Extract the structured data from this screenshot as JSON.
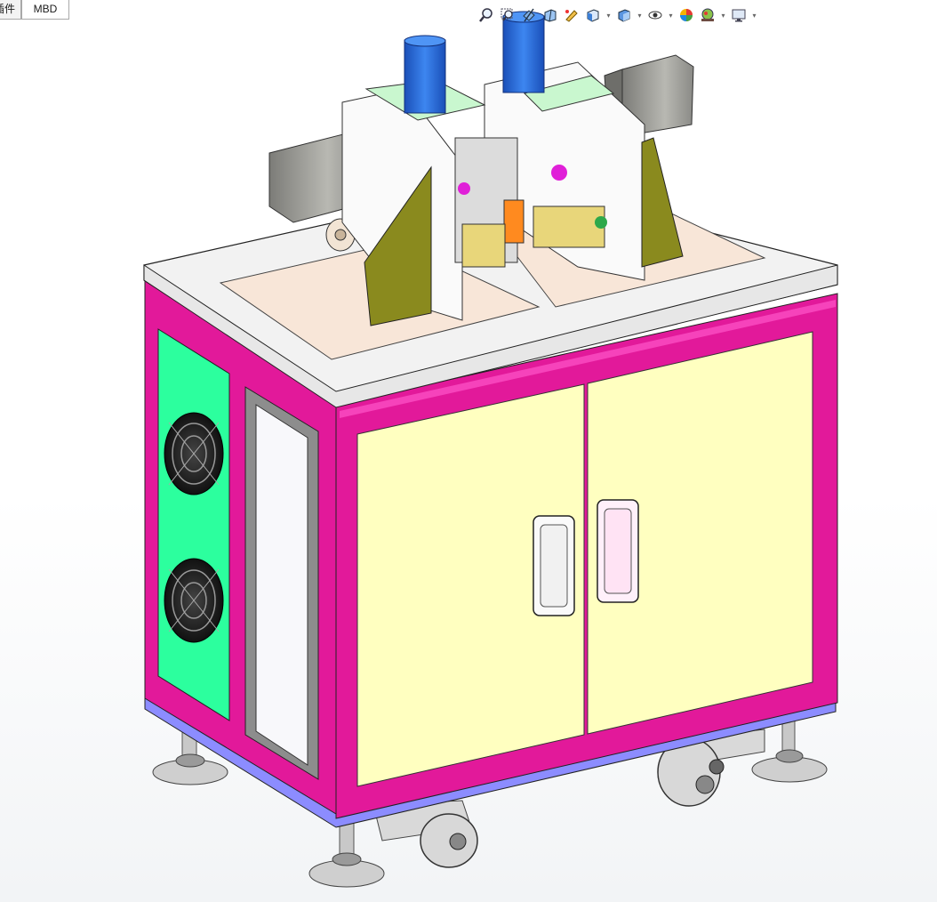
{
  "tabs": [
    {
      "label": "插件",
      "active": false
    },
    {
      "label": "MBD",
      "active": true
    }
  ],
  "heads_up_toolbar": [
    {
      "icon": "zoom-to-fit-icon",
      "dropdown": false
    },
    {
      "icon": "zoom-to-area-icon",
      "dropdown": false
    },
    {
      "icon": "previous-view-icon",
      "dropdown": false
    },
    {
      "icon": "section-view-icon",
      "dropdown": false
    },
    {
      "icon": "dynamic-annotation-icon",
      "dropdown": false
    },
    {
      "icon": "view-orientation-icon",
      "dropdown": true
    },
    {
      "icon": "display-style-icon",
      "dropdown": true
    },
    {
      "icon": "hide-show-items-icon",
      "dropdown": true
    },
    {
      "icon": "edit-appearance-icon",
      "dropdown": false
    },
    {
      "icon": "apply-scene-icon",
      "dropdown": true
    },
    {
      "icon": "view-settings-icon",
      "dropdown": true
    }
  ],
  "colors": {
    "frame_magenta": "#e2199a",
    "frame_pink_light": "#ff55c9",
    "door_yellow": "#ffffc0",
    "fan_panel_green": "#2cff9e",
    "tabletop": "#f2f2f2",
    "base_plate": "#f8e6d8",
    "motor_blue": "#2f6fd6",
    "side_gusset": "#8a8a1e",
    "stepper_gray": "#9a9a96",
    "caster_gray": "#a8a8a8"
  }
}
